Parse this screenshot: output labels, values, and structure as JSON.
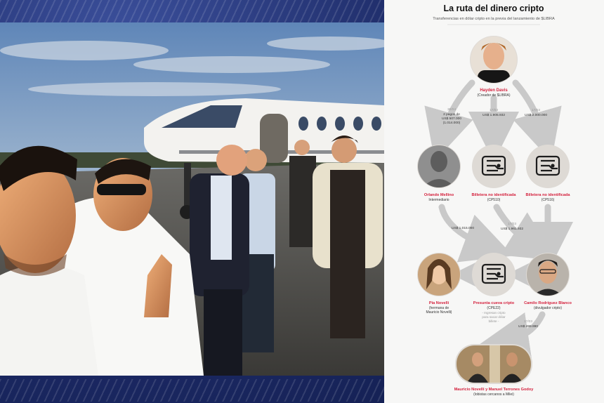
{
  "infographic": {
    "title": "La ruta del dinero cripto",
    "subtitle": "Transferencias en dólar cripto en la previa del lanzamiento de $LIBRA",
    "nodes": {
      "hayden": {
        "name": "Hayden Davis",
        "role": "(Creador de $LIBRA)"
      },
      "orlando": {
        "name": "Orlando Mellino",
        "role": "Intermediario"
      },
      "wallet1": {
        "name": "Billetera no identificada",
        "role": "(CP510)"
      },
      "wallet2": {
        "name": "Billetera no identificada",
        "role": "(CP516)"
      },
      "pia": {
        "name": "Pía Novelli",
        "role_line1": "(hermana de",
        "role_line2": "Mauricio Novelli)"
      },
      "wallet3": {
        "name": "Presunta cueva cripto",
        "role": "(CPE22)",
        "note_line1": "- Ingresan cripto",
        "note_line2": "para sacar dólar",
        "note_line3": "billete -"
      },
      "camilo": {
        "name": "Camilo Rodríguez Blanco",
        "role": "(divulgador cripto)"
      },
      "final": {
        "name": "Mauricio Novelli y Manuel Terrones Godoy",
        "role": "(lobistas cercanos a Milei)"
      }
    },
    "transfers": {
      "t1": {
        "label": "30/04",
        "line1": "2 pagos de",
        "line2": "US$ 507.000",
        "line3": "(1.014.000)"
      },
      "t2": {
        "label": "17/03",
        "amount": "US$ 1.905.932"
      },
      "t3": {
        "label": "17/03",
        "amount": "US$ 2.000.000"
      },
      "t4": {
        "amount": "US$ 1.015.000"
      },
      "t5": {
        "label": "17/03",
        "amount": "US$ 1.961.932"
      },
      "t6": {
        "label": "17/03",
        "amount": "US$ 499.990"
      }
    },
    "colors": {
      "accent": "#d4213d",
      "arrow": "#c9c9c9",
      "node_bg": "#dedad5",
      "text": "#222222"
    }
  },
  "photo": {
    "icon": "airport-selfie-photo"
  }
}
